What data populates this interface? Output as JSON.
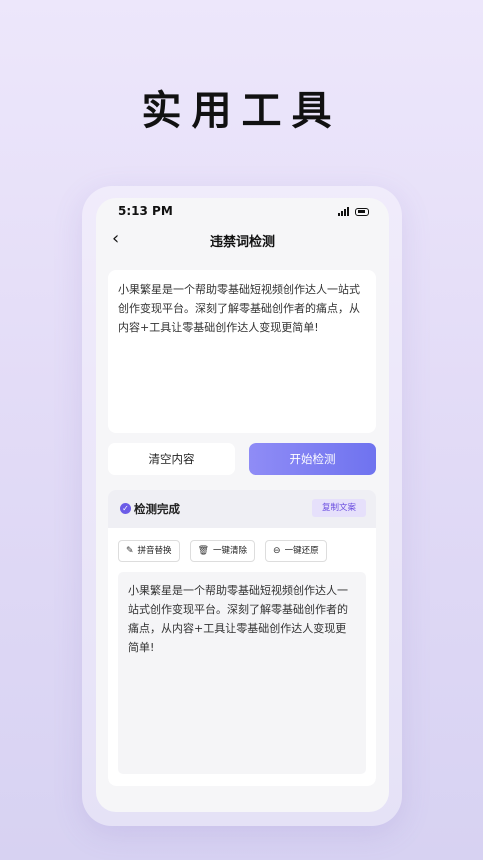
{
  "headline": "实用工具",
  "status_bar": {
    "time": "5:13 PM",
    "signal_icon": "signal-bars-icon",
    "battery_icon": "battery-icon"
  },
  "nav": {
    "back_icon": "chevron-left-icon",
    "back_glyph": "‹",
    "title": "违禁词检测"
  },
  "input": {
    "text": "小果繁星是一个帮助零基础短视频创作达人一站式创作变现平台。深刻了解零基础创作者的痛点，从内容+工具让零基础创作达人变现更简单!"
  },
  "buttons": {
    "clear_label": "清空内容",
    "start_label": "开始检测"
  },
  "result": {
    "status_icon": "check-circle-icon",
    "status_glyph": "✓",
    "status_text": "检测完成",
    "copy_label": "复制文案",
    "tools": [
      {
        "icon": "magic-wand-icon",
        "glyph": "✎",
        "label": "拼音替换"
      },
      {
        "icon": "trash-icon",
        "glyph": "🗑",
        "label": "一键清除"
      },
      {
        "icon": "restore-icon",
        "glyph": "⊖",
        "label": "一键还原"
      }
    ],
    "output_text": "小果繁星是一个帮助零基础短视频创作达人一站式创作变现平台。深刻了解零基础创作者的痛点，从内容+工具让零基础创作达人变现更简单!"
  },
  "colors": {
    "accent": "#6c5ce7",
    "button_gradient_start": "#8f8cf6",
    "button_gradient_end": "#6f73ef",
    "copy_bg": "#e6e0fb"
  }
}
